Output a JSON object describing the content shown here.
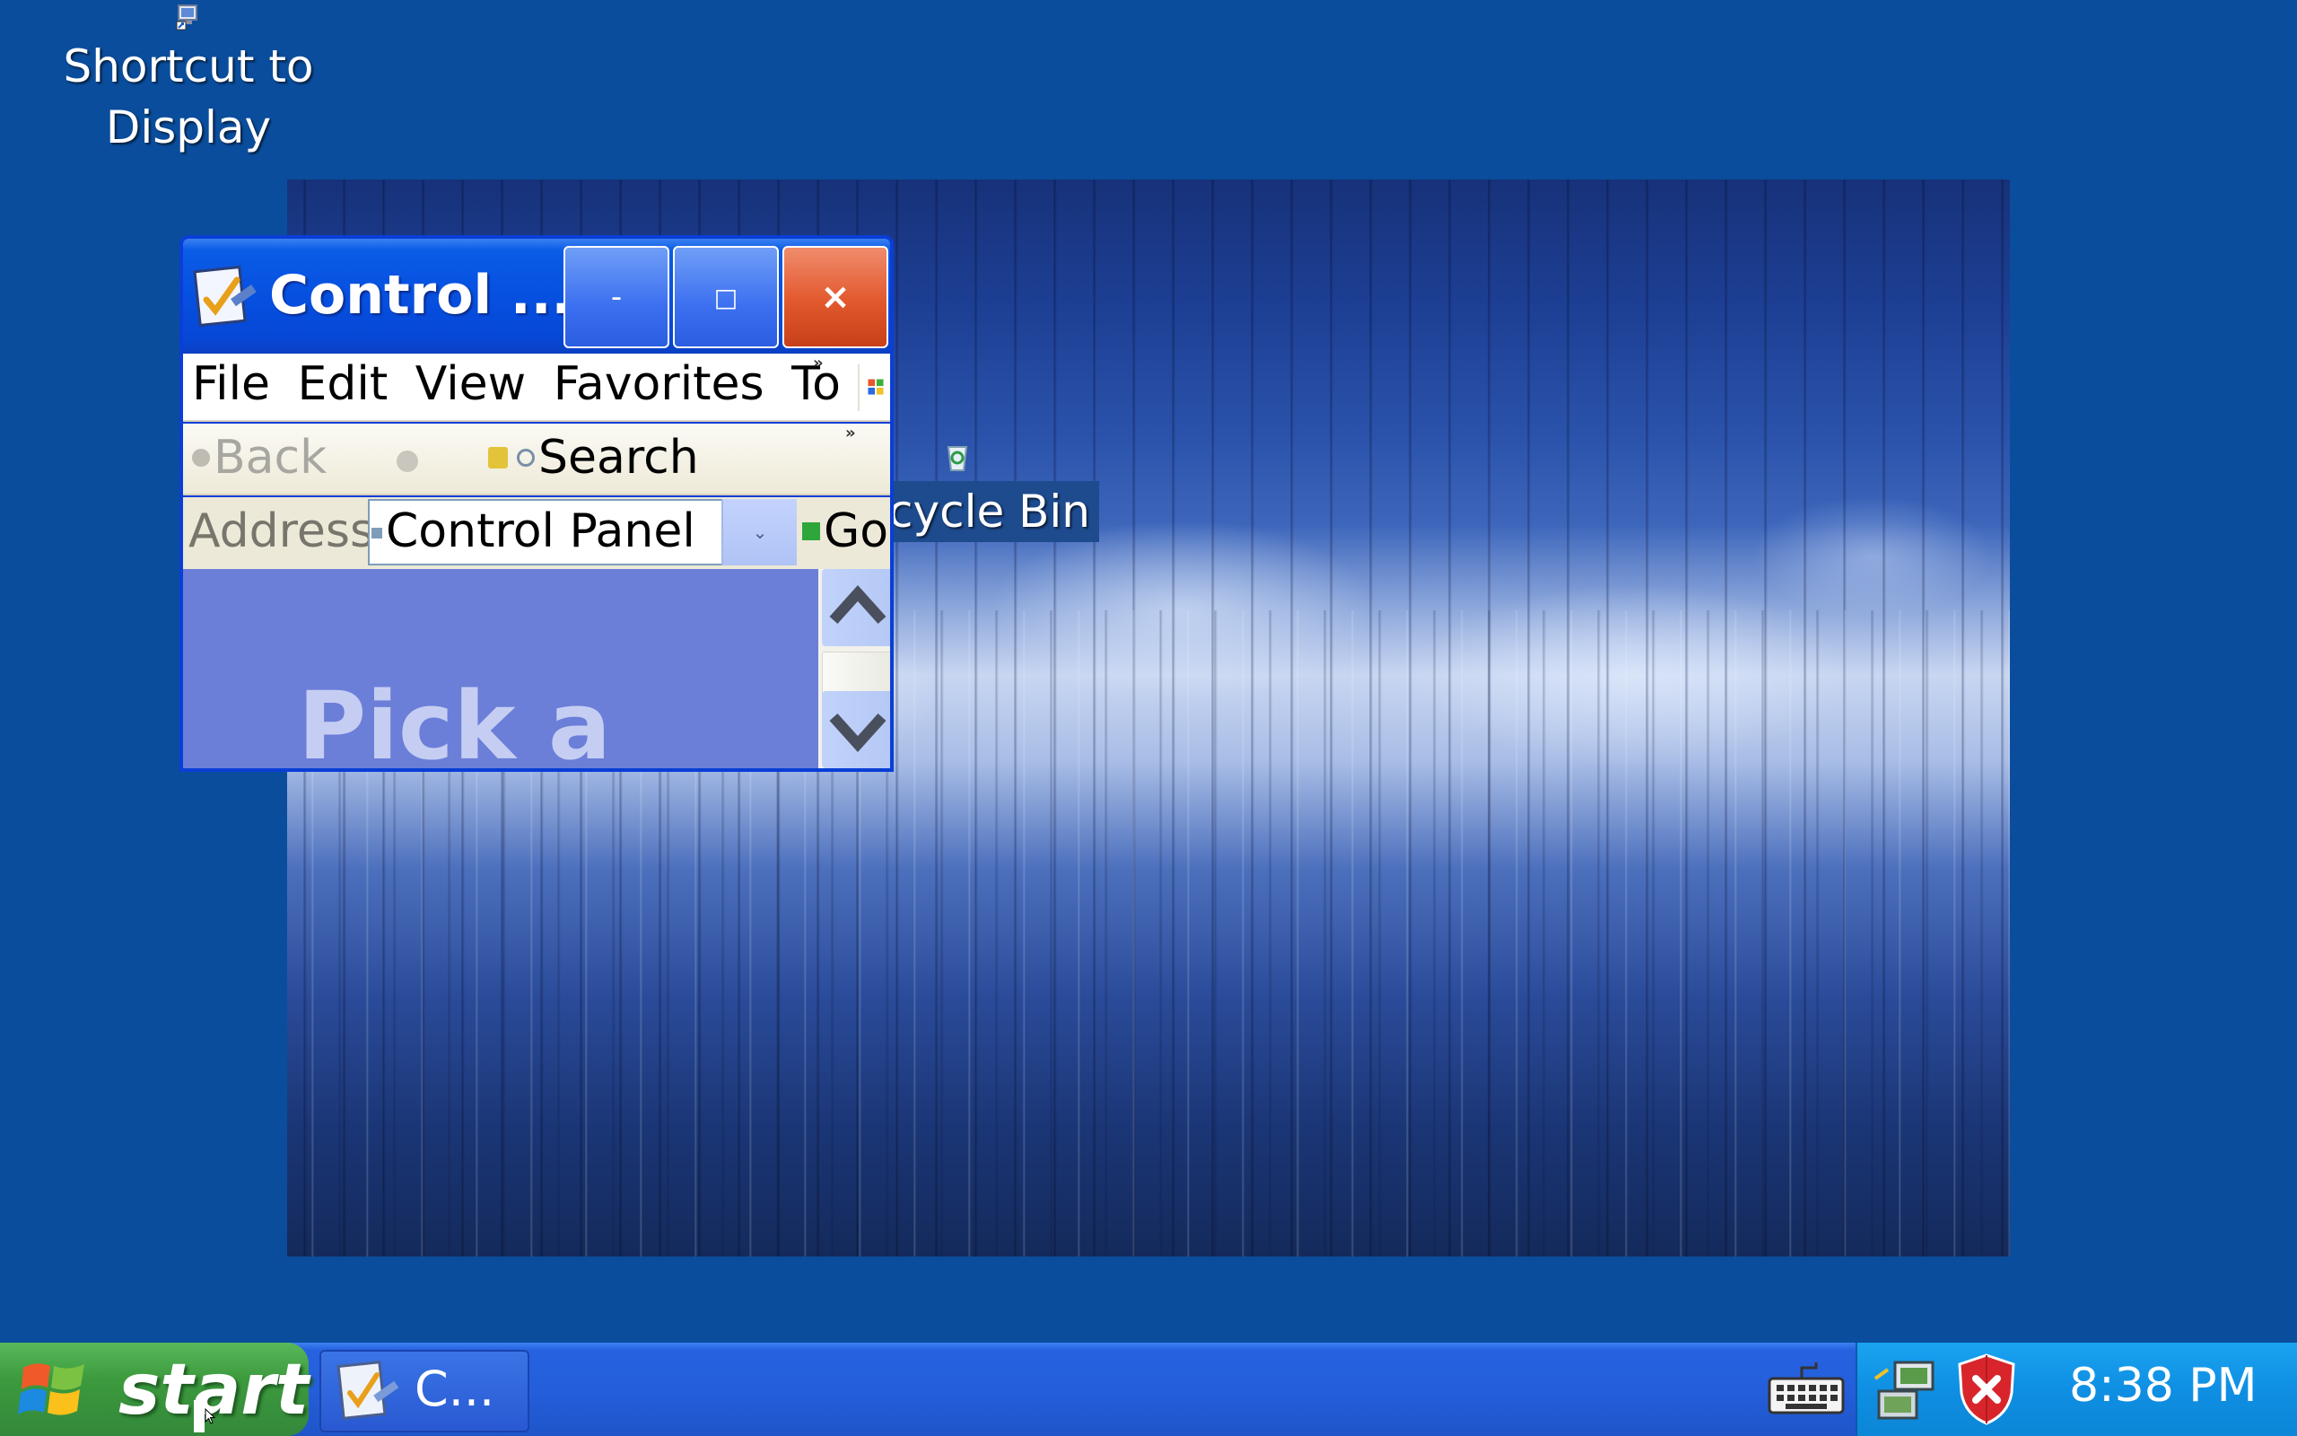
{
  "desktop": {
    "icons": [
      {
        "label_line1": "Shortcut to",
        "label_line2": "Display"
      },
      {
        "label": "cycle Bin"
      }
    ]
  },
  "window": {
    "title": "Control ...",
    "buttons": {
      "minimize": "-",
      "maximize": "□",
      "close": "×"
    },
    "menu": [
      "File",
      "Edit",
      "View",
      "Favorites",
      "To"
    ],
    "toolbar": {
      "back": "Back",
      "search": "Search"
    },
    "address": {
      "label": "Address",
      "value": "Control Panel",
      "go": "Go"
    },
    "content": {
      "heading": "Pick a"
    }
  },
  "taskbar": {
    "start_label": "start",
    "task_label": "C...",
    "clock": "8:38 PM"
  },
  "colors": {
    "desktop": "#0a4d9c",
    "titlebar": "#0650e0",
    "taskbar": "#245edb",
    "start": "#3c9a3d",
    "tray": "#0f8fe3",
    "content": "#6b7ed8"
  }
}
